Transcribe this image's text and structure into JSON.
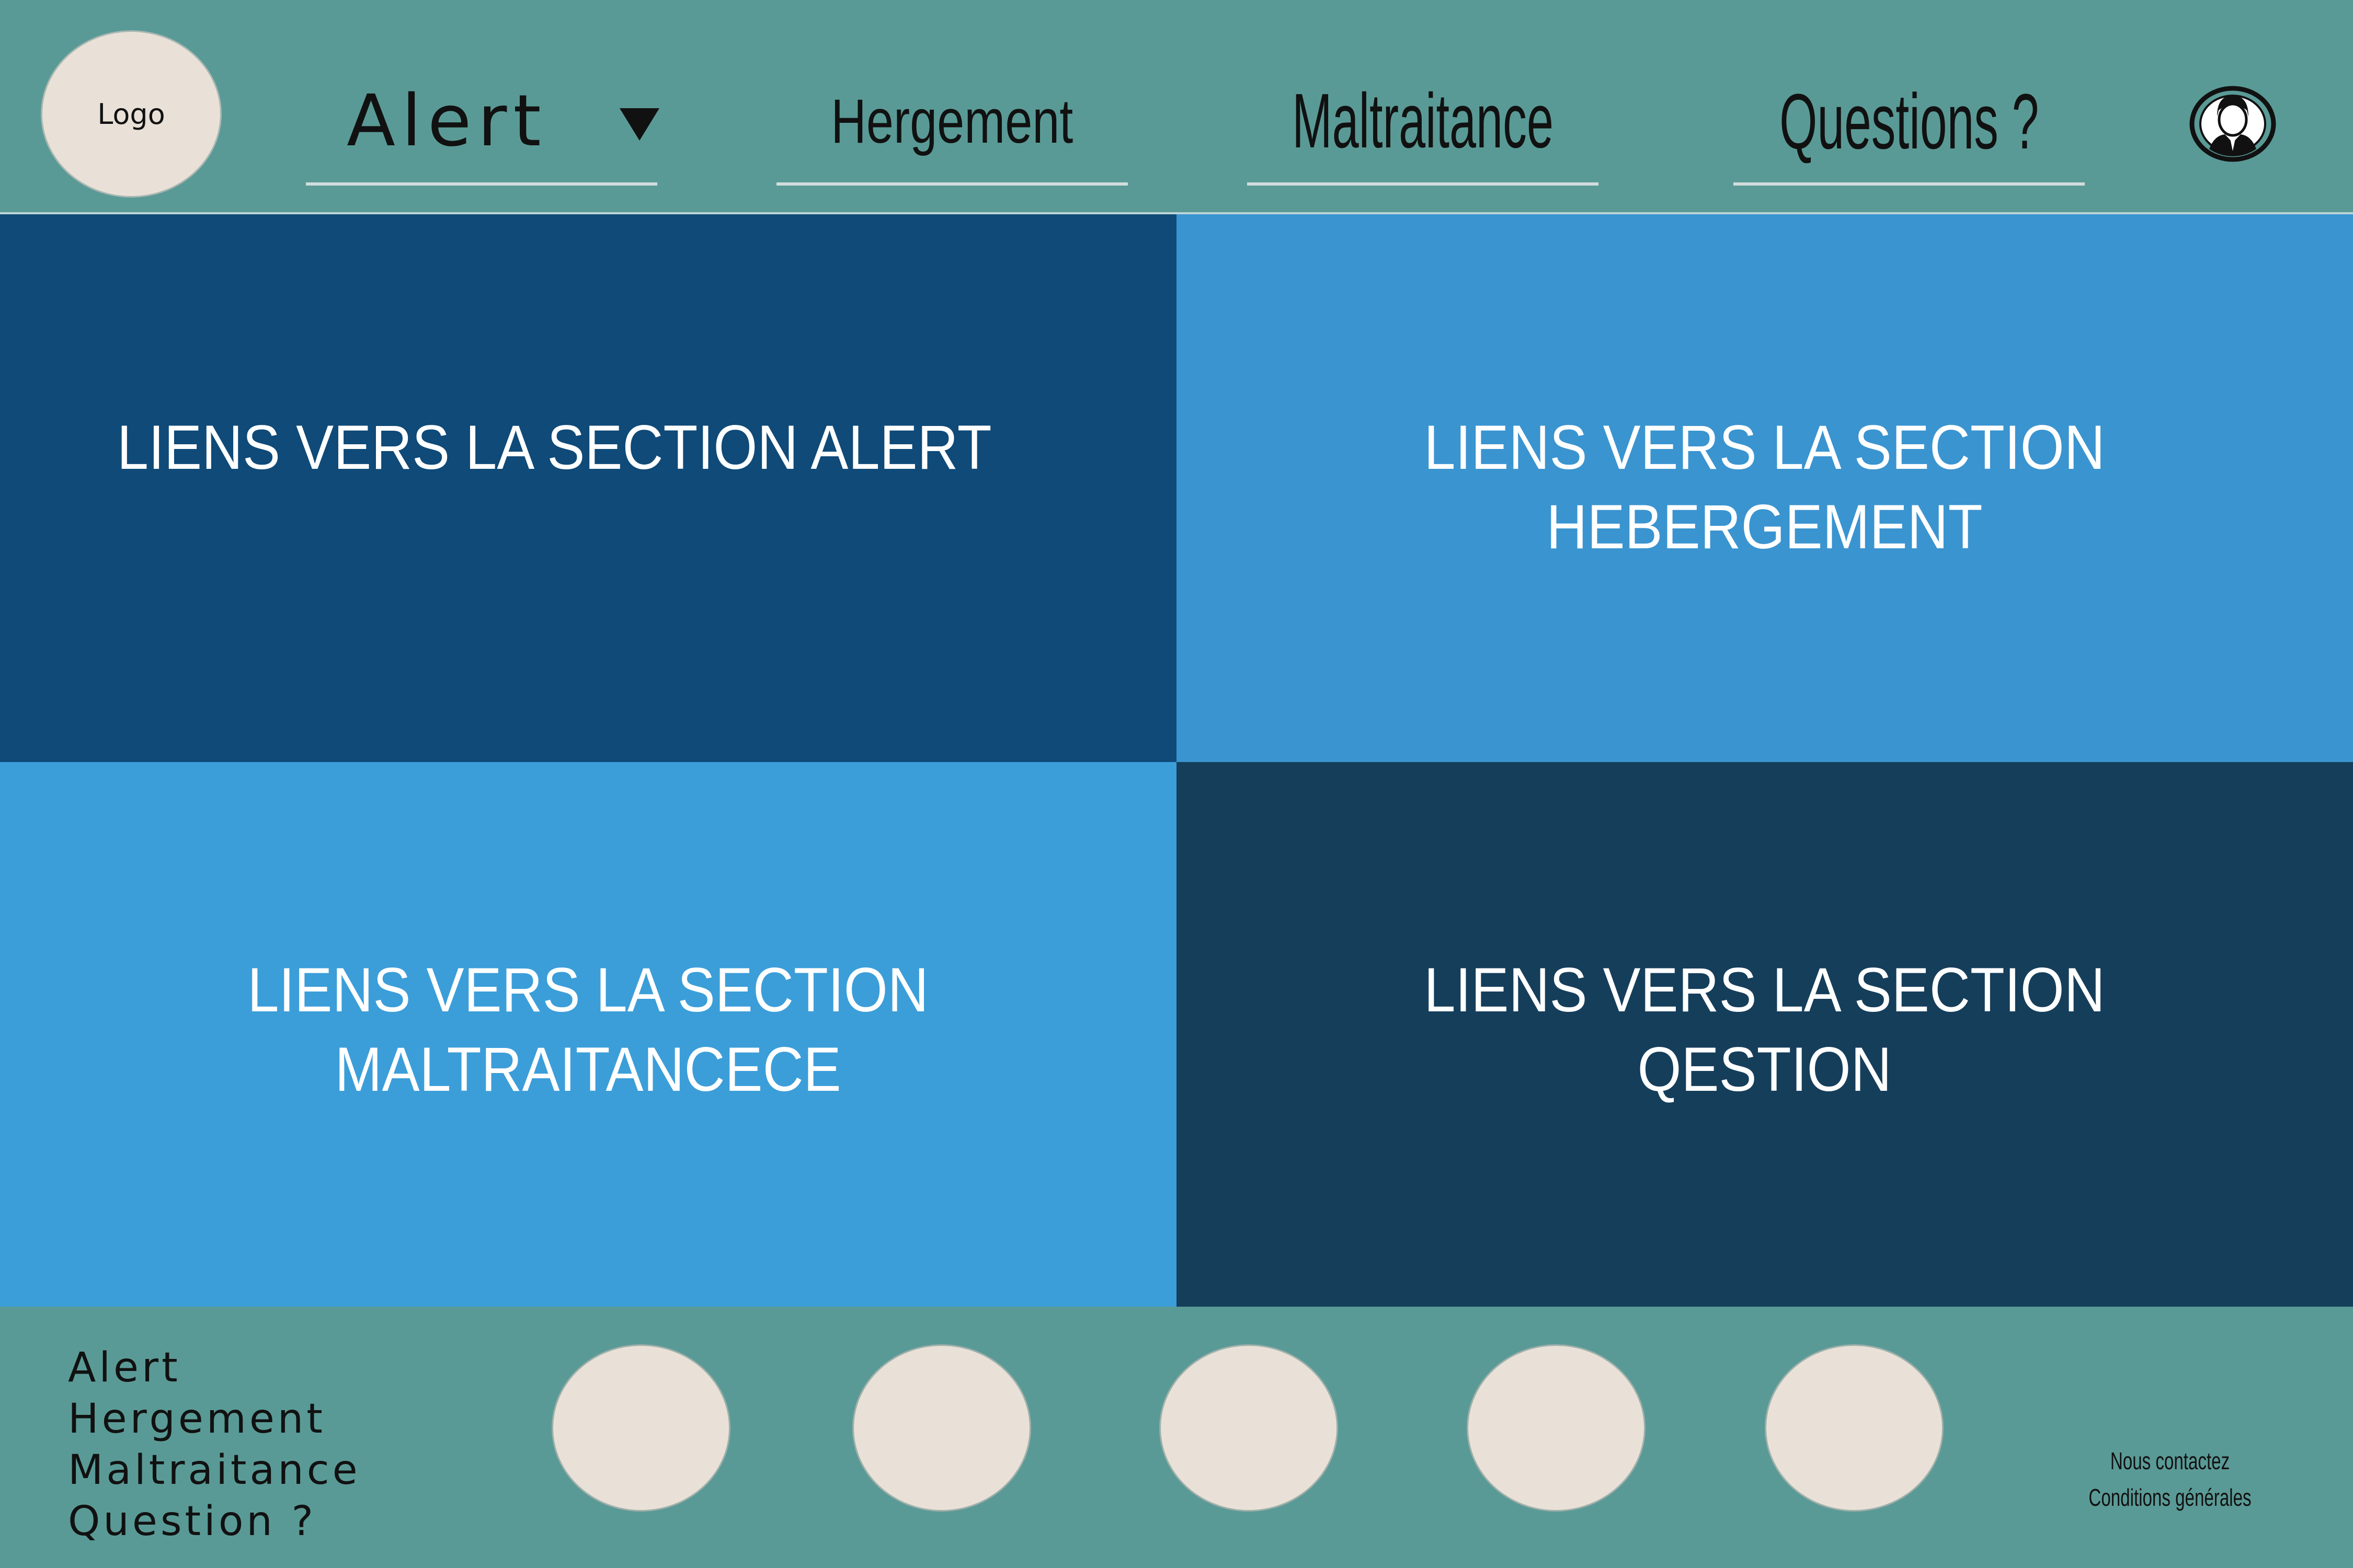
{
  "header": {
    "logo_text": "Logo",
    "nav": {
      "alert": "Alert",
      "hergement": "Hergement",
      "maltraitance": "Maltraitance",
      "questions": "Questions ?"
    },
    "user_icon": "user-avatar-icon"
  },
  "tiles": {
    "alert": "LIENS VERS LA SECTION ALERT",
    "hebergement": "LIENS VERS LA SECTION\nHEBERGEMENT",
    "maltraitance": "LIENS VERS LA SECTION\nMALTRAITANCECE",
    "question": "LIENS VERS LA SECTION\nQESTION"
  },
  "footer": {
    "links": [
      "Alert",
      "Hergement",
      "Maltraitance",
      "Question ?"
    ],
    "legal": [
      "Nous contactez",
      "Conditions générales"
    ]
  },
  "colors": {
    "bar_teal": "#5a9a96",
    "tile_dark_navy": "#0f4a78",
    "tile_light_blue": "#3a94d0",
    "tile_bright_blue": "#3b9ed9",
    "tile_deep_navy": "#153e5b",
    "circle_beige": "#e9e1d7"
  }
}
